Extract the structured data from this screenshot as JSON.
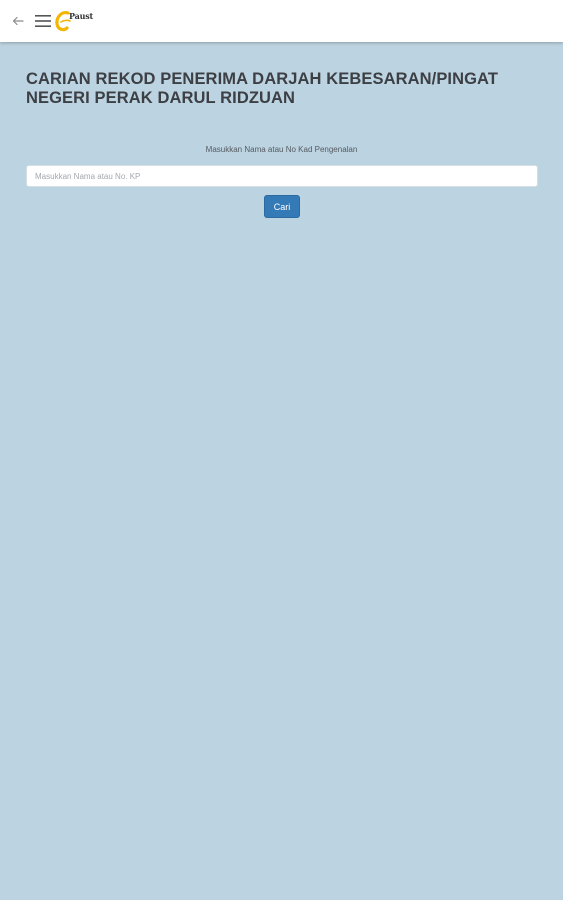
{
  "toolbar": {
    "back_icon": "arrow-left-icon",
    "menu_icon": "hamburger-menu-icon",
    "logo_text": "Paust",
    "logo_color": "#f2b600"
  },
  "main": {
    "title": "CARIAN REKOD PENERIMA DARJAH KEBESARAN/PINGAT NEGERI PERAK DARUL RIDZUAN",
    "form": {
      "label": "Masukkan Nama atau No Kad Pengenalan",
      "input_value": "",
      "input_placeholder": "Masukkan Nama atau No. KP",
      "button_label": "Cari"
    }
  },
  "colors": {
    "background": "#bcd3e1",
    "button": "#347ab6",
    "header": "#ffffff"
  }
}
